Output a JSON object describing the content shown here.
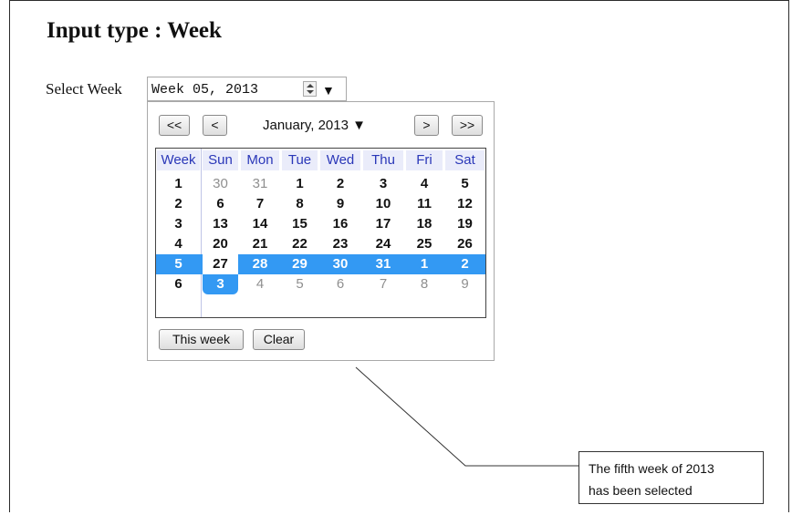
{
  "page": {
    "title": "Input type : Week",
    "select_label": "Select Week"
  },
  "week_input": {
    "value": "Week 05, 2013",
    "dropdown_arrow": "▼"
  },
  "picker": {
    "nav": {
      "prev_year": "<<",
      "prev_month": "<",
      "month_label": "January, 2013 ▼",
      "next_month": ">",
      "next_year": ">>"
    },
    "headers": [
      "Week",
      "Sun",
      "Mon",
      "Tue",
      "Wed",
      "Thu",
      "Fri",
      "Sat"
    ],
    "rows": [
      {
        "week": "1",
        "days": [
          "30",
          "31",
          "1",
          "2",
          "3",
          "4",
          "5"
        ]
      },
      {
        "week": "2",
        "days": [
          "6",
          "7",
          "8",
          "9",
          "10",
          "11",
          "12"
        ]
      },
      {
        "week": "3",
        "days": [
          "13",
          "14",
          "15",
          "16",
          "17",
          "18",
          "19"
        ]
      },
      {
        "week": "4",
        "days": [
          "20",
          "21",
          "22",
          "23",
          "24",
          "25",
          "26"
        ]
      },
      {
        "week": "5",
        "days": [
          "27",
          "28",
          "29",
          "30",
          "31",
          "1",
          "2"
        ]
      },
      {
        "week": "6",
        "days": [
          "3",
          "4",
          "5",
          "6",
          "7",
          "8",
          "9"
        ]
      }
    ],
    "selected_week": "5",
    "buttons": {
      "this_week": "This week",
      "clear": "Clear"
    }
  },
  "callout": {
    "line1": "The fifth week of 2013",
    "line2": "has been selected"
  },
  "colors": {
    "selection": "#3399f3",
    "header_text": "#2a37b8",
    "header_bg": "#eaecfa"
  }
}
